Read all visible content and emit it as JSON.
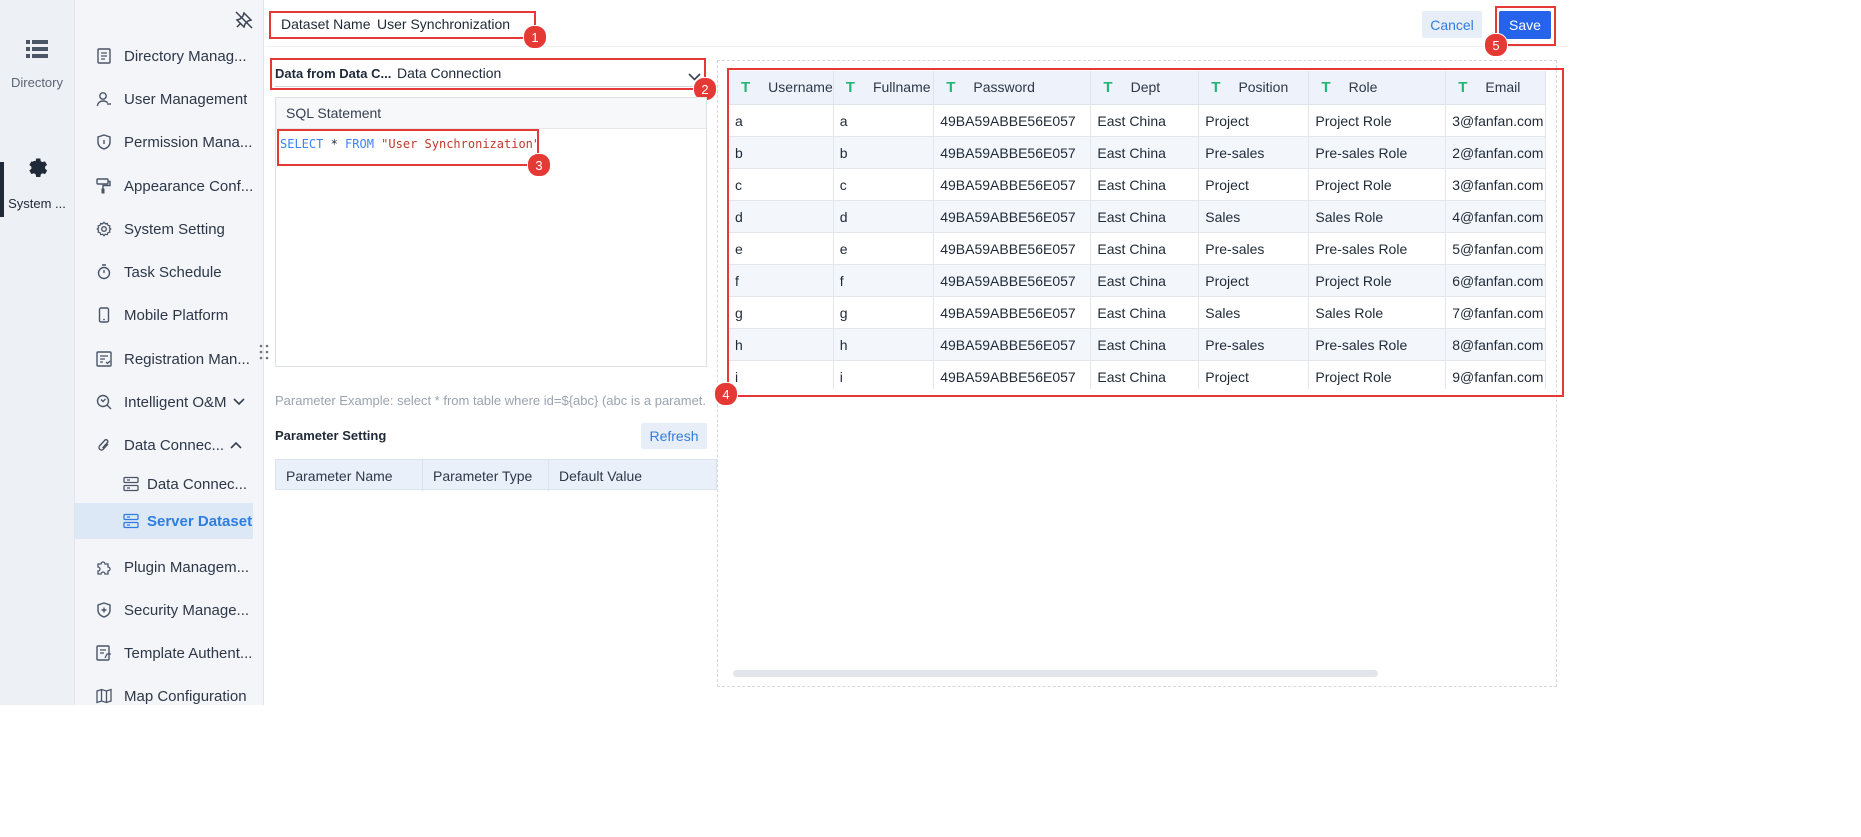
{
  "rail": {
    "items": [
      {
        "label": "Directory",
        "icon": "list-icon"
      },
      {
        "label": "System ...",
        "icon": "gear-icon"
      }
    ]
  },
  "sidebar": {
    "items": [
      {
        "label": "Directory Manag...",
        "icon": "document-icon"
      },
      {
        "label": "User Management",
        "icon": "user-icon"
      },
      {
        "label": "Permission Mana...",
        "icon": "shield-icon"
      },
      {
        "label": "Appearance Conf...",
        "icon": "paint-roller-icon"
      },
      {
        "label": "System Setting",
        "icon": "gear-icon"
      },
      {
        "label": "Task Schedule",
        "icon": "stopwatch-icon"
      },
      {
        "label": "Mobile Platform",
        "icon": "mobile-icon"
      },
      {
        "label": "Registration Man...",
        "icon": "registration-icon"
      },
      {
        "label": "Intelligent O&M",
        "icon": "om-icon"
      },
      {
        "label": "Data Connec...",
        "icon": "paperclip-icon"
      },
      {
        "label": "Data Connec...",
        "icon": "server-icon"
      },
      {
        "label": "Server Dataset",
        "icon": "dataset-icon"
      },
      {
        "label": "Plugin Managem...",
        "icon": "puzzle-icon"
      },
      {
        "label": "Security Manage...",
        "icon": "shield-plus-icon"
      },
      {
        "label": "Template Authent...",
        "icon": "template-icon"
      },
      {
        "label": "Map Configuration",
        "icon": "map-icon"
      }
    ]
  },
  "header": {
    "dataset_name_label": "Dataset Name",
    "dataset_name_value": "User Synchronization",
    "cancel_label": "Cancel",
    "save_label": "Save"
  },
  "left": {
    "source_label": "Data from Data C...",
    "source_value": "Data Connection",
    "sql_header": "SQL Statement",
    "sql": {
      "kw1": "SELECT",
      "star": " * ",
      "kw2": "FROM",
      "table": " \"User Synchronization\""
    },
    "param_hint": "Parameter Example: select * from table where id=${abc} (abc is a paramet...",
    "param_setting": "Parameter Setting",
    "refresh_label": "Refresh",
    "param_columns": [
      "Parameter Name",
      "Parameter Type",
      "Default Value"
    ]
  },
  "preview": {
    "columns": [
      "Username",
      "Fullname",
      "Password",
      "Dept",
      "Position",
      "Role",
      "Email"
    ],
    "rows": [
      [
        "a",
        "a",
        "49BA59ABBE56E057",
        "East China",
        "Project",
        "Project Role",
        "3@fanfan.com"
      ],
      [
        "b",
        "b",
        "49BA59ABBE56E057",
        "East China",
        "Pre-sales",
        "Pre-sales Role",
        "2@fanfan.com"
      ],
      [
        "c",
        "c",
        "49BA59ABBE56E057",
        "East China",
        "Project",
        "Project Role",
        "3@fanfan.com"
      ],
      [
        "d",
        "d",
        "49BA59ABBE56E057",
        "East China",
        "Sales",
        "Sales Role",
        "4@fanfan.com"
      ],
      [
        "e",
        "e",
        "49BA59ABBE56E057",
        "East China",
        "Pre-sales",
        "Pre-sales Role",
        "5@fanfan.com"
      ],
      [
        "f",
        "f",
        "49BA59ABBE56E057",
        "East China",
        "Project",
        "Project Role",
        "6@fanfan.com"
      ],
      [
        "g",
        "g",
        "49BA59ABBE56E057",
        "East China",
        "Sales",
        "Sales Role",
        "7@fanfan.com"
      ],
      [
        "h",
        "h",
        "49BA59ABBE56E057",
        "East China",
        "Pre-sales",
        "Pre-sales Role",
        "8@fanfan.com"
      ],
      [
        "i",
        "i",
        "49BA59ABBE56E057",
        "East China",
        "Project",
        "Project Role",
        "9@fanfan.com"
      ]
    ]
  },
  "annotations": [
    "1",
    "2",
    "3",
    "4",
    "5"
  ],
  "colors": {
    "accent": "#2f7de1",
    "save_bg": "#2563eb",
    "highlight": "#e53935"
  }
}
